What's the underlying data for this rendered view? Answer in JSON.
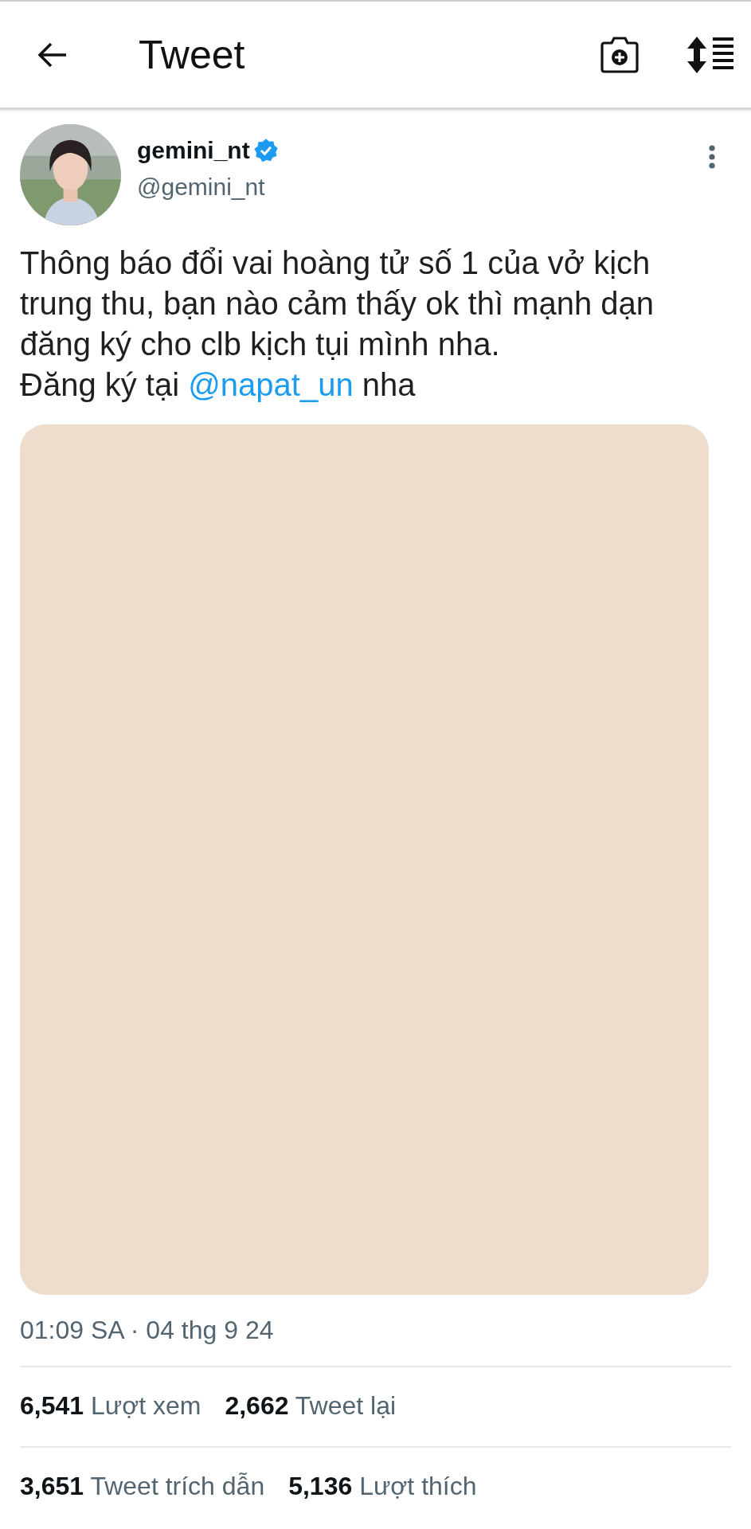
{
  "header": {
    "title": "Tweet"
  },
  "author": {
    "name": "gemini_nt",
    "verified": true,
    "handle": "@gemini_nt"
  },
  "tweet": {
    "text": "Thông báo đổi vai hoàng tử số 1 của vở kịch trung thu, bạn nào cảm thấy ok thì mạnh dạn đăng ký cho clb kịch tụi mình nha.\nĐăng ký tại ",
    "mention": "@napat_un",
    "text_after": " nha"
  },
  "timestamp": "01:09 SA · 04 thg 9 24",
  "stat_rows": [
    {
      "items": [
        {
          "count": "6,541",
          "label": "Lượt xem"
        },
        {
          "count": "2,662",
          "label": "Tweet lại"
        }
      ]
    },
    {
      "items": [
        {
          "count": "3,651",
          "label": "Tweet trích dẫn"
        },
        {
          "count": "5,136",
          "label": "Lượt thích"
        }
      ]
    }
  ]
}
